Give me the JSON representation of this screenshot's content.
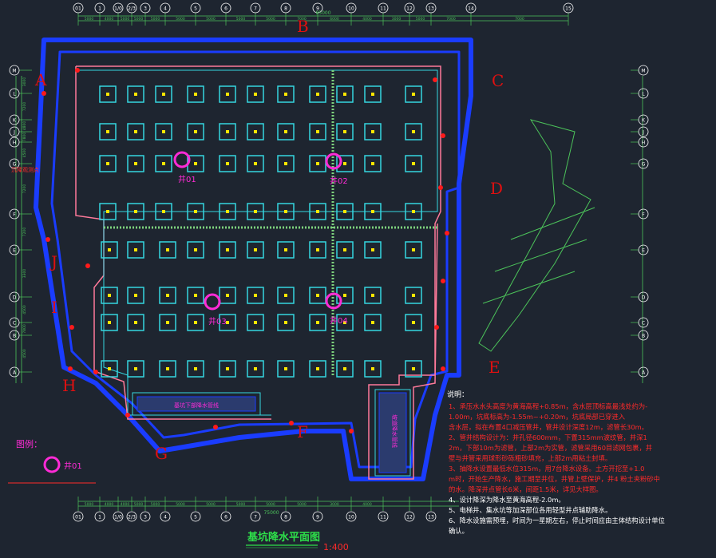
{
  "colors": {
    "background": "#1e2530",
    "dim": "#4cc35a",
    "axis_bubble": "#ffffff",
    "pit_outline": "#ff7a9a",
    "wall_blue": "#1a3cff",
    "pile_cap": "#35d6e0",
    "pile": "#ffe600",
    "well": "#ff2bd6",
    "red_letter": "#e01010",
    "notes_red": "#ff2a2a",
    "notes_yellow": "#ffe600",
    "title": "#2ee04a",
    "scale": "#ff2a2a"
  },
  "top_axes": [
    "01",
    "1",
    "1/0",
    "2/3",
    "3",
    "4",
    "5",
    "6",
    "7",
    "8",
    "9",
    "10",
    "11",
    "12",
    "13",
    "14",
    "15"
  ],
  "left_axes": [
    "M",
    "L",
    "K",
    "J",
    "H",
    "G",
    "F",
    "E",
    "D",
    "C",
    "B",
    "A"
  ],
  "top_dims": [
    "5000",
    "4000",
    "5000",
    "5000",
    "5000",
    "5000",
    "5000",
    "5000",
    "5000",
    "7000",
    "6000",
    "4000",
    "3000",
    "5000",
    "7000",
    "7000"
  ],
  "bottom_dims": [
    "5000",
    "4000",
    "4000",
    "5000",
    "5000",
    "5000",
    "5000",
    "5000",
    "5000",
    "5000",
    "3000",
    "4000"
  ],
  "total_dim_top": "85000",
  "total_dim_bottom": "75000",
  "left_dims": [
    "3000",
    "7200",
    "4800",
    "7800",
    "4500",
    "7200",
    "7200",
    "3300",
    "4500",
    "7800",
    "4500"
  ],
  "section_letters": [
    "A",
    "B",
    "C",
    "D",
    "E",
    "F",
    "G",
    "H",
    "I",
    "J"
  ],
  "wells": [
    "井01",
    "井02",
    "井03",
    "井04"
  ],
  "legend": {
    "title": "图例：",
    "symbol_label": "井01"
  },
  "notes_title": "说明：",
  "notes": [
    "1、承压水水头高度为黄海高程+0.85m，含水层顶标高最浅处约为-1.00m，坑底标高为-1.55m~+0.20m，坑底局部已穿进入含水层，拟在布置4口减压管井，管井设计深度12m，滤管长30m。",
    "2、管井结构设计为：井孔径600mm，下置315mm波纹管，井深12m，下部10m为滤管，上部2m为实管，滤管采用60目滤网包裹，井壁与井管采用球形砂砾粗砂填充，上部2m用粘土封填。",
    "3、抽降水设置最低水位315m，用7台降水设备。土方开挖至+1.0m时，开始生产降水，施工期至井位，井管上壁保护，井4 粉土夹粉砂中的水。降深井点管长6米，间距1.5米，详见大样图。",
    "4、设计降深为降水至黄海高程-2.0m。",
    "5、电梯井、集水坑等加深部位各用轻型井点辅助降水。",
    "6、降水设施需预埋，时间为一星期左右，停止时间应由主体结构设计单位确认。"
  ],
  "drawing_title": "基坑降水平面图",
  "scale": "1:400",
  "annotations": {
    "left_label": "沉降观测点",
    "bottom_band": "基坑下部降水管线",
    "ramp_band": "坡道降水管线"
  }
}
